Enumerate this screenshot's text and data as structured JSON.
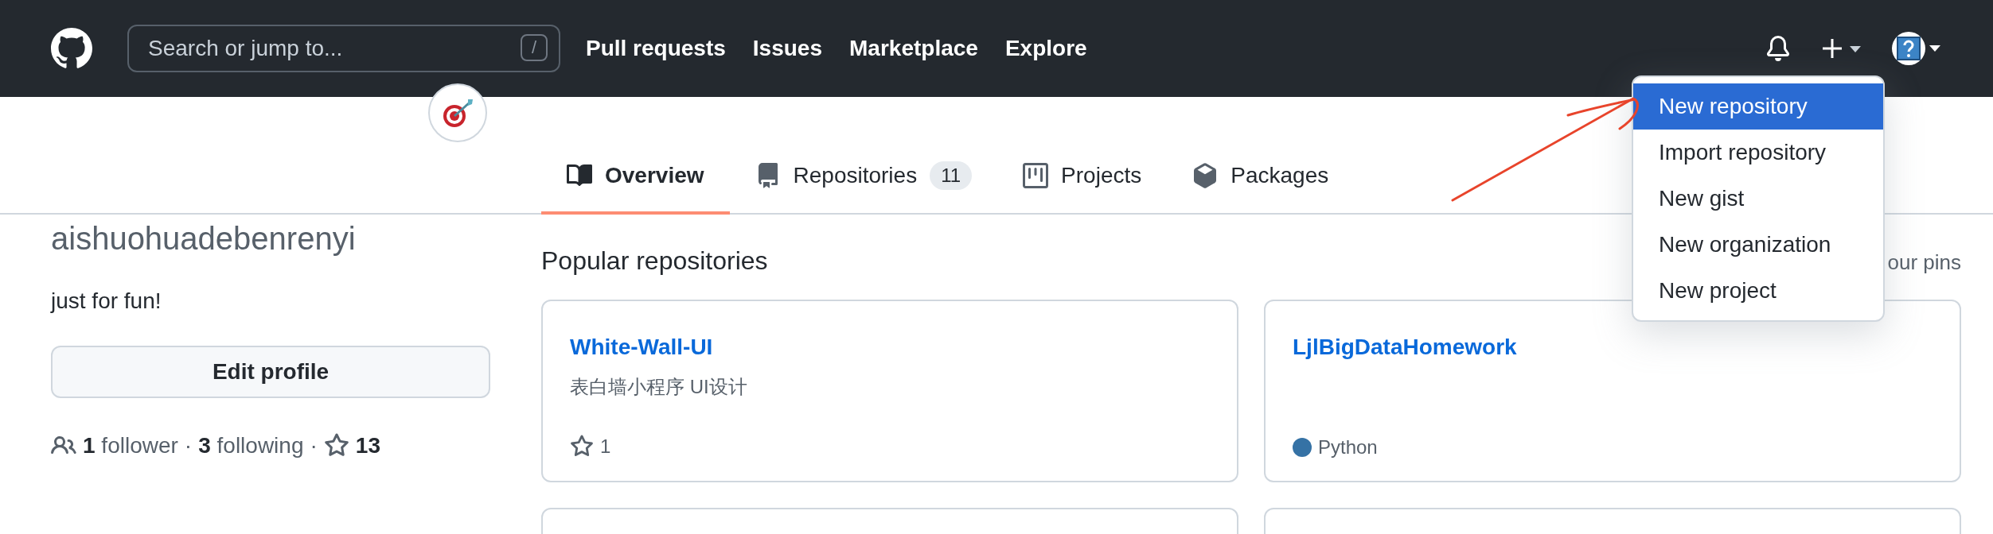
{
  "header": {
    "search": {
      "placeholder": "Search or jump to...",
      "shortcut": "/"
    },
    "nav": [
      "Pull requests",
      "Issues",
      "Marketplace",
      "Explore"
    ]
  },
  "new_menu": {
    "items": [
      {
        "label": "New repository",
        "selected": true
      },
      {
        "label": "Import repository",
        "selected": false
      },
      {
        "label": "New gist",
        "selected": false
      },
      {
        "label": "New organization",
        "selected": false
      },
      {
        "label": "New project",
        "selected": false
      }
    ]
  },
  "tabs": [
    {
      "kind": "book",
      "label": "Overview",
      "selected": true
    },
    {
      "kind": "repo",
      "label": "Repositories",
      "count": "11",
      "selected": false
    },
    {
      "kind": "project",
      "label": "Projects",
      "selected": false
    },
    {
      "kind": "package",
      "label": "Packages",
      "selected": false
    }
  ],
  "profile": {
    "username": "aishuohuadebenrenyi",
    "bio": "just for fun!",
    "edit_button": "Edit profile",
    "followers": "**1** follower",
    "following": "**3** following",
    "separator": "·",
    "star_count": "13"
  },
  "popular": {
    "title": "Popular repositories",
    "customize": "our pins",
    "repos": [
      {
        "name": "White-Wall-UI",
        "description": "表白墙小程序 UI设计",
        "star_count": "1"
      },
      {
        "name": "LjlBigDataHomework",
        "language": "Python",
        "color": "#3572a5"
      }
    ]
  }
}
